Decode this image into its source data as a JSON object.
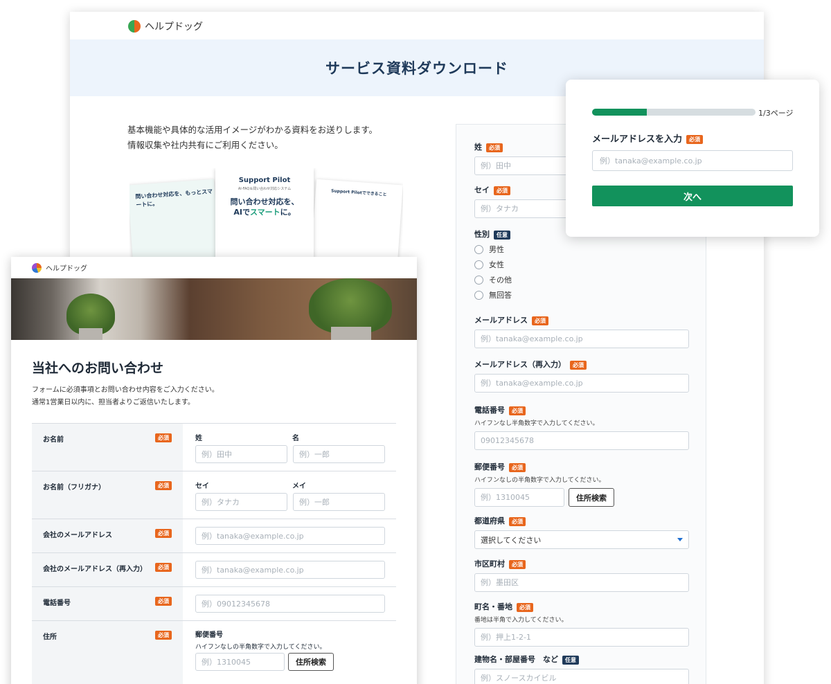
{
  "brand": {
    "name": "ヘルプドッグ"
  },
  "download": {
    "title": "サービス資料ダウンロード",
    "intro": [
      "基本機能や具体的な活用イメージがわかる資料をお送りします。",
      "情報収集や社内共有にご利用ください。"
    ],
    "docs": {
      "left_title": "問い合わせ対応を、もっとスマートに。",
      "center_brand": "Support Pilot",
      "center_sub": "AI-FAQ＆問い合わせ対応システム",
      "center_headline_1": "問い合わせ対応を、",
      "center_headline_2a": "AIで",
      "center_headline_2b": "スマート",
      "center_headline_2c": "に。",
      "right_title": "Support Pilotでできること"
    },
    "form": {
      "sei": {
        "label": "姓",
        "badge": "必須",
        "placeholder": "例）田中"
      },
      "sei_kana": {
        "label": "セイ",
        "badge": "必須",
        "placeholder": "例）タナカ"
      },
      "gender": {
        "label": "性別",
        "badge": "任意",
        "options": [
          "男性",
          "女性",
          "その他",
          "無回答"
        ]
      },
      "email": {
        "label": "メールアドレス",
        "badge": "必須",
        "placeholder": "例）tanaka@example.co.jp"
      },
      "email_confirm": {
        "label": "メールアドレス（再入力）",
        "badge": "必須",
        "placeholder": "例）tanaka@example.co.jp"
      },
      "phone": {
        "label": "電話番号",
        "badge": "必須",
        "hint": "ハイフンなし半角数字で入力してください。",
        "placeholder": "09012345678"
      },
      "zip": {
        "label": "郵便番号",
        "badge": "必須",
        "hint": "ハイフンなしの半角数字で入力してください。",
        "placeholder": "例）1310045",
        "button": "住所検索"
      },
      "pref": {
        "label": "都道府県",
        "badge": "必須",
        "value": "選択してください"
      },
      "city": {
        "label": "市区町村",
        "badge": "必須",
        "placeholder": "例）墨田区"
      },
      "street": {
        "label": "町名・番地",
        "badge": "必須",
        "hint": "番地は半角で入力してください。",
        "placeholder": "例）押上1-2-1"
      },
      "building": {
        "label": "建物名・部屋番号　など",
        "badge": "任意",
        "placeholder": "例）スノースカイビル"
      }
    }
  },
  "popup": {
    "progress": 0.333,
    "page_label": "1/3ページ",
    "title": "メールアドレスを入力",
    "badge": "必須",
    "placeholder": "例）tanaka@example.co.jp",
    "next_button": "次へ"
  },
  "contact": {
    "title": "当社へのお問い合わせ",
    "desc": [
      "フォームに必須事項とお問い合わせ内容をご入力ください。",
      "通常1営業日以内に、担当者よりご返信いたします。"
    ],
    "badge": "必須",
    "name": {
      "label": "お名前",
      "sub1": "姓",
      "sub2": "名",
      "ph1": "例）田中",
      "ph2": "例）一郎"
    },
    "kana": {
      "label": "お名前（フリガナ）",
      "sub1": "セイ",
      "sub2": "メイ",
      "ph1": "例）タナカ",
      "ph2": "例）一郎"
    },
    "email": {
      "label": "会社のメールアドレス",
      "placeholder": "例）tanaka@example.co.jp"
    },
    "email_confirm": {
      "label": "会社のメールアドレス（再入力）",
      "placeholder": "例）tanaka@example.co.jp"
    },
    "phone": {
      "label": "電話番号",
      "placeholder": "例）09012345678"
    },
    "address": {
      "label": "住所",
      "zip_label": "郵便番号",
      "hint": "ハイフンなしの半角数字で入力してください。",
      "zip_placeholder": "例）1310045",
      "button": "住所検索"
    }
  }
}
